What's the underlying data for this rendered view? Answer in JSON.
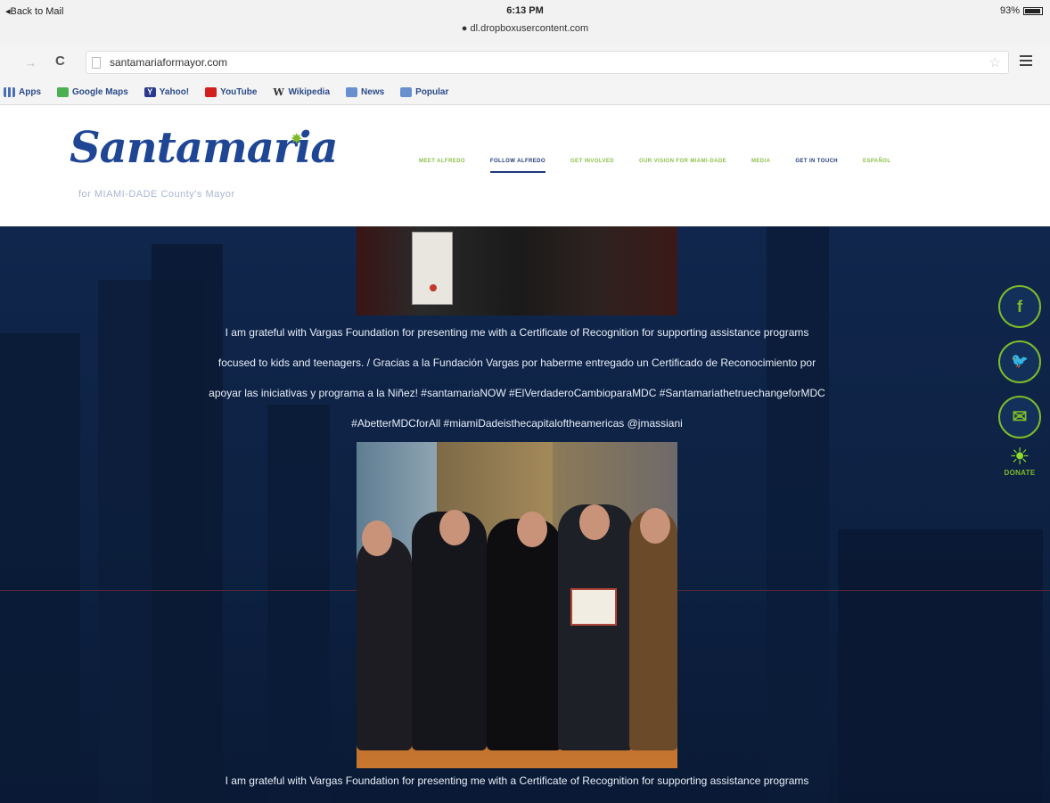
{
  "status_bar": {
    "back": "◂Back to Mail",
    "time": "6:13 PM",
    "host": "● dl.dropboxusercontent.com",
    "battery": "93%"
  },
  "browser": {
    "url": "santamariaformayor.com",
    "bookmarks": [
      "Apps",
      "Google Maps",
      "Yahoo!",
      "YouTube",
      "Wikipedia",
      "News",
      "Popular"
    ]
  },
  "site": {
    "logo": "Santamaria",
    "tagline": "for MIAMI-DADE County's Mayor",
    "nav": [
      "MEET ALFREDO",
      "FOLLOW ALFREDO",
      "GET INVOLVED",
      "OUR VISION FOR MIAMI-DADE",
      "MEDIA",
      "GET IN TOUCH",
      "ESPAÑOL"
    ]
  },
  "post1": {
    "caption_lines": [
      "I am grateful with Vargas Foundation for presenting me with a Certificate of Recognition for supporting assistance programs",
      "focused to kids and teenagers. / Gracias a la Fundación Vargas por haberme entregado un Certificado de Reconocimiento por",
      "apoyar las iniciativas y programa a la Niñez! #santamariaNOW #ElVerdaderoCambioparaMDC #SantamariathetruechangeforMDC",
      "#AbetterMDCforAll #miamiDadeisthecapitaloftheamericas @jmassiani"
    ]
  },
  "post2": {
    "caption": "I am grateful with Vargas Foundation for presenting me with a Certificate of Recognition for supporting assistance programs"
  },
  "social": {
    "facebook_glyph": "f",
    "donate": "DONATE"
  },
  "colors": {
    "brand_blue": "#1f4694",
    "accent_green": "#7dbb2a",
    "background_navy": "#10264c"
  }
}
